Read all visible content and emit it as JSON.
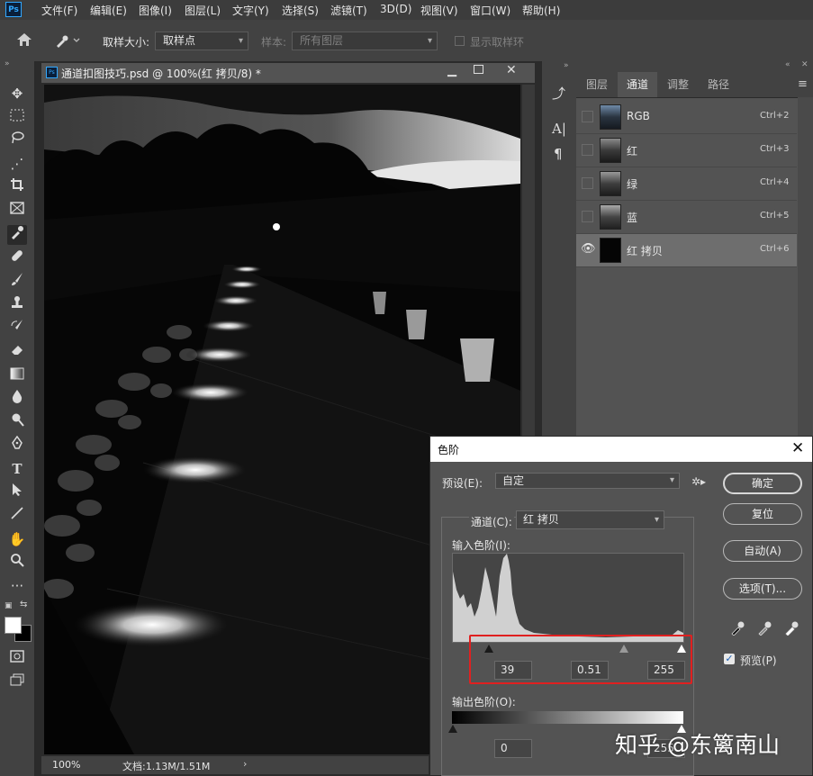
{
  "app": {
    "logo": "Ps"
  },
  "menu": [
    "文件(F)",
    "编辑(E)",
    "图像(I)",
    "图层(L)",
    "文字(Y)",
    "选择(S)",
    "滤镜(T)",
    "3D(D)",
    "视图(V)",
    "窗口(W)",
    "帮助(H)"
  ],
  "options": {
    "sample_size_label": "取样大小:",
    "sample_size_value": "取样点",
    "sample_label": "样本:",
    "sample_value": "所有图层",
    "show_ring_label": "显示取样环"
  },
  "tools": [
    "move-icon",
    "marquee-icon",
    "lasso-icon",
    "magic-wand-icon",
    "crop-icon",
    "frame-icon",
    "eyedropper-icon",
    "healing-icon",
    "brush-icon",
    "stamp-icon",
    "history-brush-icon",
    "eraser-icon",
    "gradient-icon",
    "blur-icon",
    "dodge-icon",
    "pen-icon",
    "type-icon",
    "path-select-icon",
    "line-icon",
    "hand-icon",
    "zoom-icon",
    "more-icon"
  ],
  "document": {
    "title": "通道扣图技巧.psd @ 100%(红 拷贝/8) *",
    "zoom": "100%",
    "doc_size": "文档:1.13M/1.51M"
  },
  "panel": {
    "tabs": [
      "图层",
      "通道",
      "调整",
      "路径"
    ],
    "active_tab": "通道",
    "channels": [
      {
        "name": "RGB",
        "shortcut": "Ctrl+2",
        "visible": false,
        "selected": false
      },
      {
        "name": "红",
        "shortcut": "Ctrl+3",
        "visible": false,
        "selected": false
      },
      {
        "name": "绿",
        "shortcut": "Ctrl+4",
        "visible": false,
        "selected": false
      },
      {
        "name": "蓝",
        "shortcut": "Ctrl+5",
        "visible": false,
        "selected": false
      },
      {
        "name": "红 拷贝",
        "shortcut": "Ctrl+6",
        "visible": true,
        "selected": true
      }
    ]
  },
  "levels_dialog": {
    "title": "色阶",
    "preset_label": "预设(E):",
    "preset_value": "自定",
    "channel_label": "通道(C):",
    "channel_value": "红 拷贝",
    "input_levels_label": "输入色阶(I):",
    "input_black": "39",
    "input_gamma": "0.51",
    "input_white": "255",
    "output_levels_label": "输出色阶(O):",
    "output_black": "0",
    "output_white": "255",
    "buttons": {
      "ok": "确定",
      "reset": "复位",
      "auto": "自动(A)",
      "options": "选项(T)..."
    },
    "preview_label": "预览(P)",
    "preview_checked": true
  },
  "watermark": "知乎 @东篱南山",
  "colors": {
    "accent": "#31a8ff",
    "highlight_box": "#e02020"
  }
}
